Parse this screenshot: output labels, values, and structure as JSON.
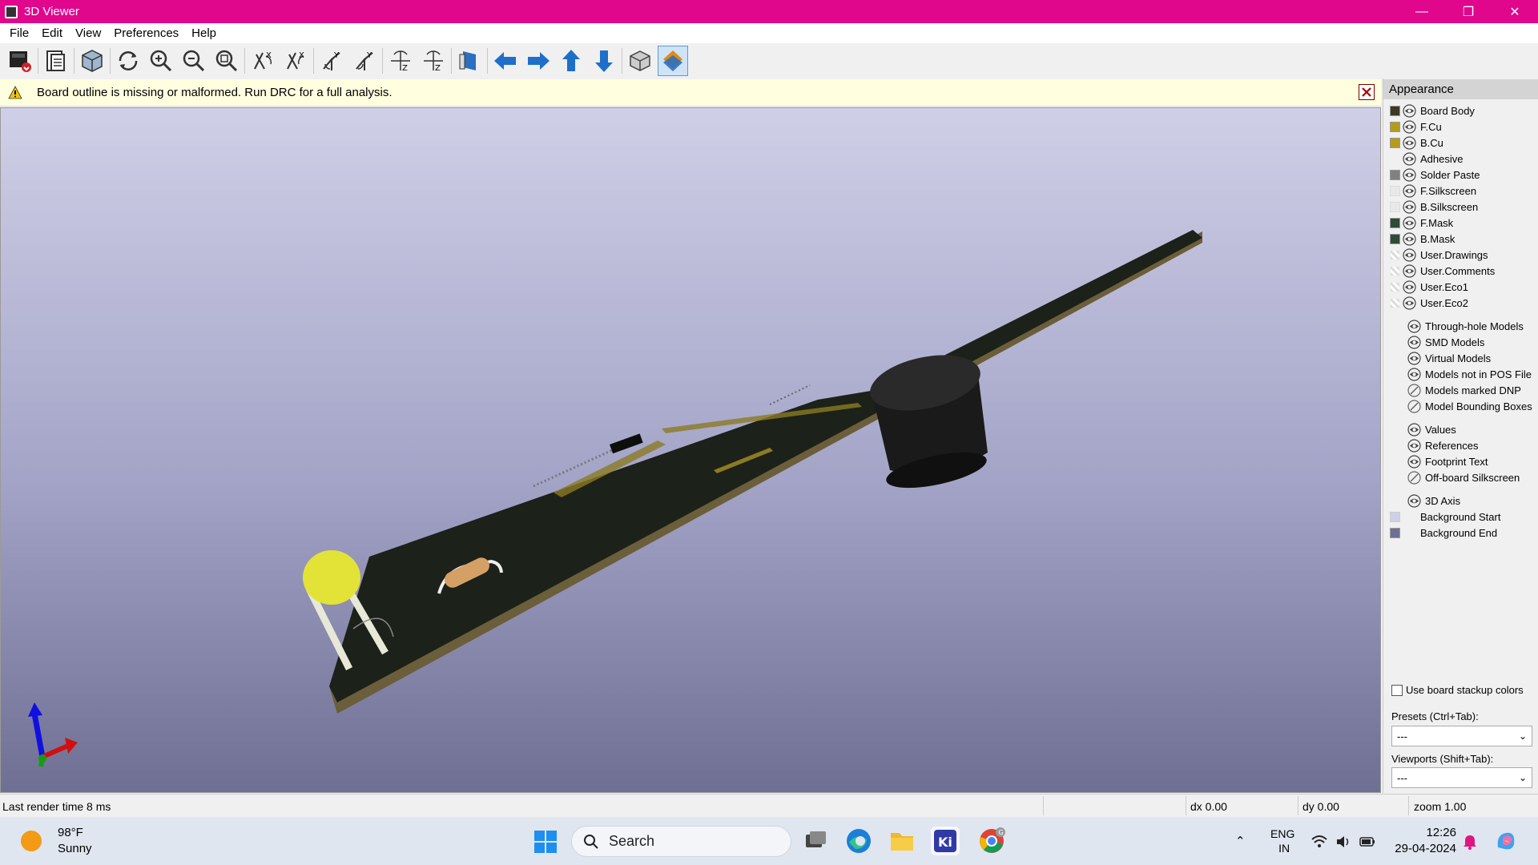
{
  "window": {
    "title": "3D Viewer",
    "controls": [
      "—",
      "❐",
      "✕"
    ]
  },
  "menu": [
    "File",
    "Edit",
    "View",
    "Preferences",
    "Help"
  ],
  "toolbar": {
    "buttons": [
      "render-options",
      "copy-to-clipboard",
      "reload-board",
      "rotate-view",
      "zoom-in",
      "zoom-out",
      "zoom-fit",
      "rotate-x-ccw",
      "rotate-x-cw",
      "rotate-y-ccw",
      "rotate-y-cw",
      "rotate-z-ccw",
      "rotate-z-cw",
      "flip-board",
      "move-left",
      "move-right",
      "move-up",
      "move-down",
      "orthographic",
      "toggle-raytracing"
    ]
  },
  "infobar": {
    "message": "Board outline is missing or malformed. Run DRC for a full analysis."
  },
  "appearance": {
    "title": "Appearance",
    "layers": [
      {
        "name": "Board Body",
        "color": "#3a3a24",
        "visible": true
      },
      {
        "name": "F.Cu",
        "color": "#b39c1a",
        "visible": true
      },
      {
        "name": "B.Cu",
        "color": "#b39c1a",
        "visible": true
      },
      {
        "name": "Adhesive",
        "color": "",
        "visible": true
      },
      {
        "name": "Solder Paste",
        "color": "#808080",
        "visible": true
      },
      {
        "name": "F.Silkscreen",
        "color": "#e8e8e8",
        "visible": true
      },
      {
        "name": "B.Silkscreen",
        "color": "#e8e8e8",
        "visible": true
      },
      {
        "name": "F.Mask",
        "color": "#2f4a3a",
        "visible": true
      },
      {
        "name": "B.Mask",
        "color": "#2f4a3a",
        "visible": true
      },
      {
        "name": "User.Drawings",
        "color": "checker",
        "visible": true
      },
      {
        "name": "User.Comments",
        "color": "checker",
        "visible": true
      },
      {
        "name": "User.Eco1",
        "color": "checker",
        "visible": true
      },
      {
        "name": "User.Eco2",
        "color": "checker",
        "visible": true
      }
    ],
    "models": [
      {
        "name": "Through-hole Models",
        "visible": true
      },
      {
        "name": "SMD Models",
        "visible": true
      },
      {
        "name": "Virtual Models",
        "visible": true
      },
      {
        "name": "Models not in POS File",
        "visible": true
      },
      {
        "name": "Models marked DNP",
        "visible": false
      },
      {
        "name": "Model Bounding Boxes",
        "visible": false
      }
    ],
    "text_items": [
      {
        "name": "Values",
        "visible": true
      },
      {
        "name": "References",
        "visible": true
      },
      {
        "name": "Footprint Text",
        "visible": true
      },
      {
        "name": "Off-board Silkscreen",
        "visible": false
      }
    ],
    "misc": [
      {
        "name": "3D Axis",
        "visible": true,
        "color": ""
      },
      {
        "name": "Background Start",
        "visible": null,
        "color": "#cfcfe7"
      },
      {
        "name": "Background End",
        "visible": null,
        "color": "#6f6f93"
      }
    ],
    "use_stackup_label": "Use board stackup colors",
    "presets_label": "Presets (Ctrl+Tab):",
    "presets_value": "---",
    "viewports_label": "Viewports (Shift+Tab):",
    "viewports_value": "---"
  },
  "status": {
    "render_time": "Last render time 8 ms",
    "dx": "dx 0.00",
    "dy": "dy 0.00",
    "zoom": "zoom 1.00"
  },
  "taskbar": {
    "weather_temp": "98°F",
    "weather_desc": "Sunny",
    "search_placeholder": "Search",
    "lang1": "ENG",
    "lang2": "IN",
    "time": "12:26",
    "date": "29-04-2024",
    "badge": "G"
  }
}
